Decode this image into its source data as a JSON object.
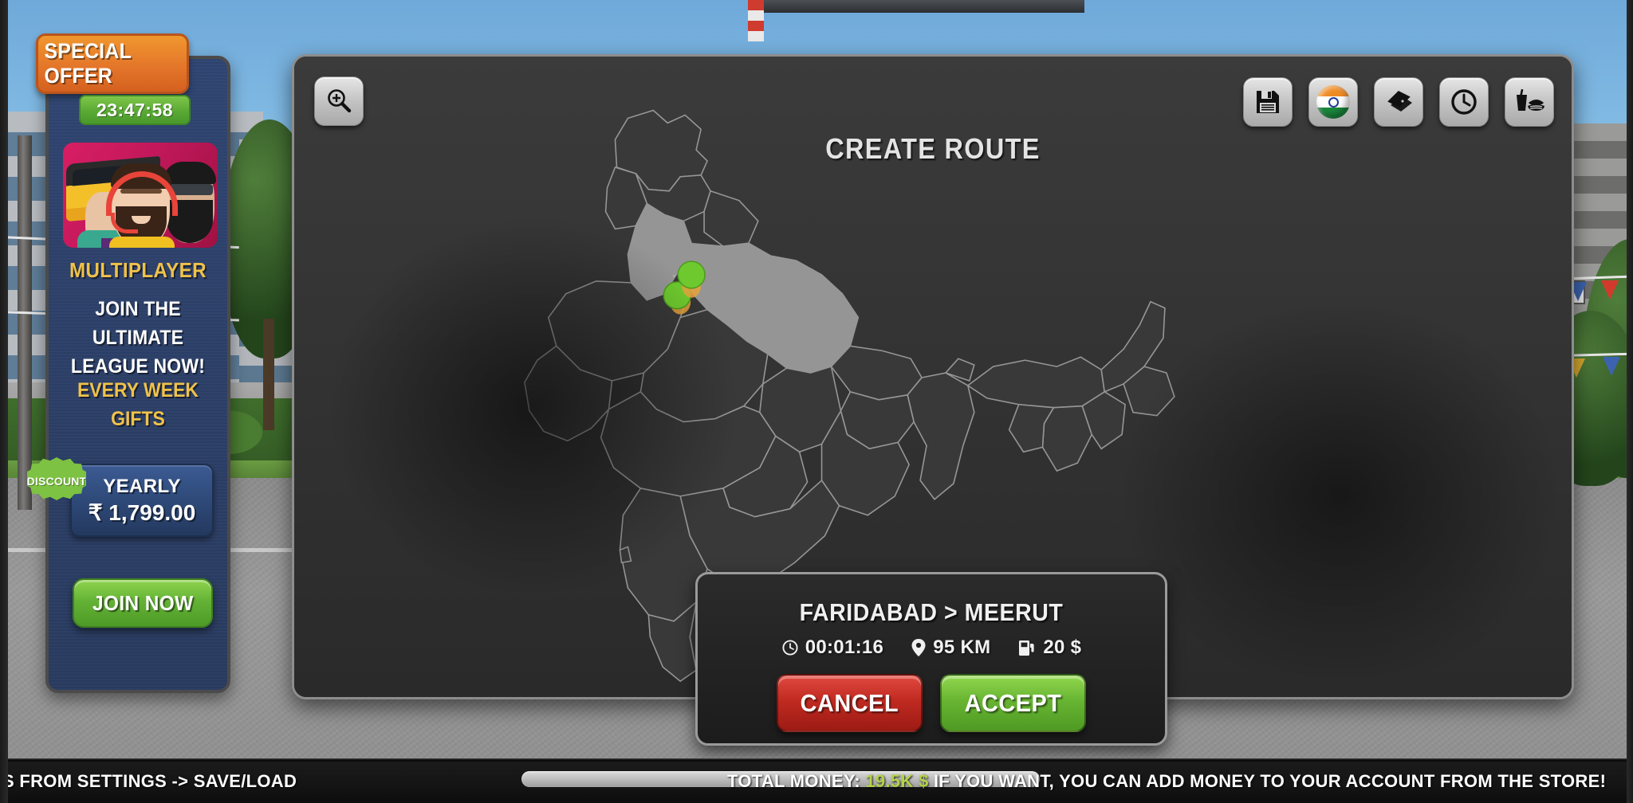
{
  "offer_panel": {
    "badge_label": "SPECIAL OFFER",
    "timer": "23:47:58",
    "ad_title": "MULTIPLAYER",
    "ad_subtitle": "JOIN THE ULTIMATE LEAGUE NOW!",
    "ad_gift_text": "EVERY WEEK GIFTS",
    "discount_label": "DISCOUNT",
    "price_label": "YEARLY",
    "price_value": "₹ 1,799.00",
    "join_label": "JOIN NOW",
    "ad_icon": "multiplayer-bus-avatars-icon"
  },
  "map_panel": {
    "title": "CREATE ROUTE",
    "zoom_icon": "zoom-in-icon",
    "toolbar": [
      {
        "name": "save-icon",
        "label": "Save"
      },
      {
        "name": "india-flag-icon",
        "label": "Country"
      },
      {
        "name": "tickets-icon",
        "label": "Tickets"
      },
      {
        "name": "clock-icon",
        "label": "Time"
      },
      {
        "name": "food-drink-icon",
        "label": "Food"
      }
    ],
    "markers": [
      {
        "name": "route-marker-start",
        "color": "#6ec92e"
      },
      {
        "name": "route-marker-end",
        "color": "#6ec92e"
      }
    ],
    "highlight_color": "#9b9b9b",
    "land_color": "#3a3a3a"
  },
  "route_dialog": {
    "title": "FARIDABAD > MEERUT",
    "stats": [
      {
        "icon": "clock-icon",
        "value": "00:01:16"
      },
      {
        "icon": "map-pin-icon",
        "value": "95 KM"
      },
      {
        "icon": "fuel-pump-icon",
        "value": "20 $"
      }
    ],
    "cancel_label": "CANCEL",
    "accept_label": "ACCEPT"
  },
  "bottom_bar": {
    "left_text": "SS FROM SETTINGS -> SAVE/LOAD",
    "money_prefix": "TOTAL MONEY: ",
    "money_value": "19.5K $",
    "tip_text": "  IF YOU WANT, YOU CAN ADD MONEY TO YOUR ACCOUNT FROM THE STORE!"
  },
  "colors": {
    "accent_green": "#6ec92e",
    "accent_orange": "#e4762a",
    "accent_gold": "#f0c24a",
    "danger_red": "#c02a21",
    "panel_dark": "#333333"
  }
}
